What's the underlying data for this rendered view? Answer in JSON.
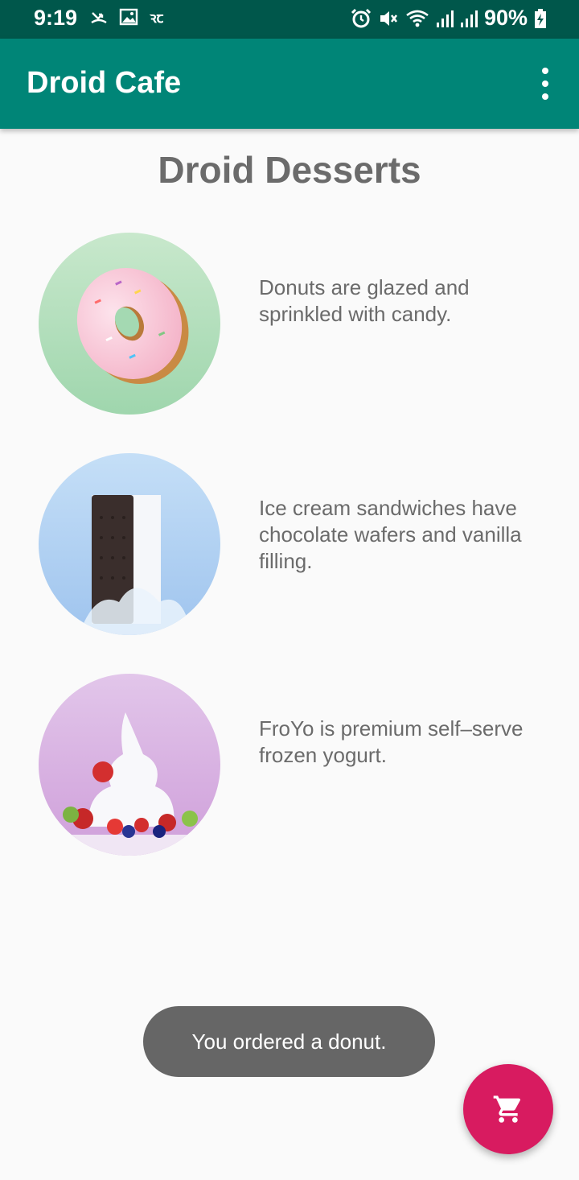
{
  "status_bar": {
    "time": "9:19",
    "battery_percent": "90%",
    "left_icons": [
      "missed-call-icon",
      "image-icon",
      "notification-text-icon"
    ],
    "right_icons": [
      "alarm-icon",
      "mute-icon",
      "wifi-icon",
      "signal-icon",
      "signal-icon",
      "battery-charging-icon"
    ]
  },
  "app_bar": {
    "title": "Droid Cafe",
    "menu_icon": "overflow-menu-icon"
  },
  "main": {
    "heading": "Droid Desserts",
    "items": [
      {
        "name": "donut",
        "description": "Donuts are glazed and sprinkled with candy."
      },
      {
        "name": "ice-cream-sandwich",
        "description": "Ice cream sandwiches have chocolate wafers and vanilla filling."
      },
      {
        "name": "froyo",
        "description": "FroYo is premium self–serve frozen yogurt."
      }
    ]
  },
  "toast": {
    "message": "You ordered a donut."
  },
  "fab": {
    "icon": "shopping-cart-icon"
  },
  "colors": {
    "status_bar": "#00574b",
    "app_bar": "#008577",
    "fab": "#d81b60",
    "text": "#6b6b6b",
    "toast": "#666666"
  }
}
